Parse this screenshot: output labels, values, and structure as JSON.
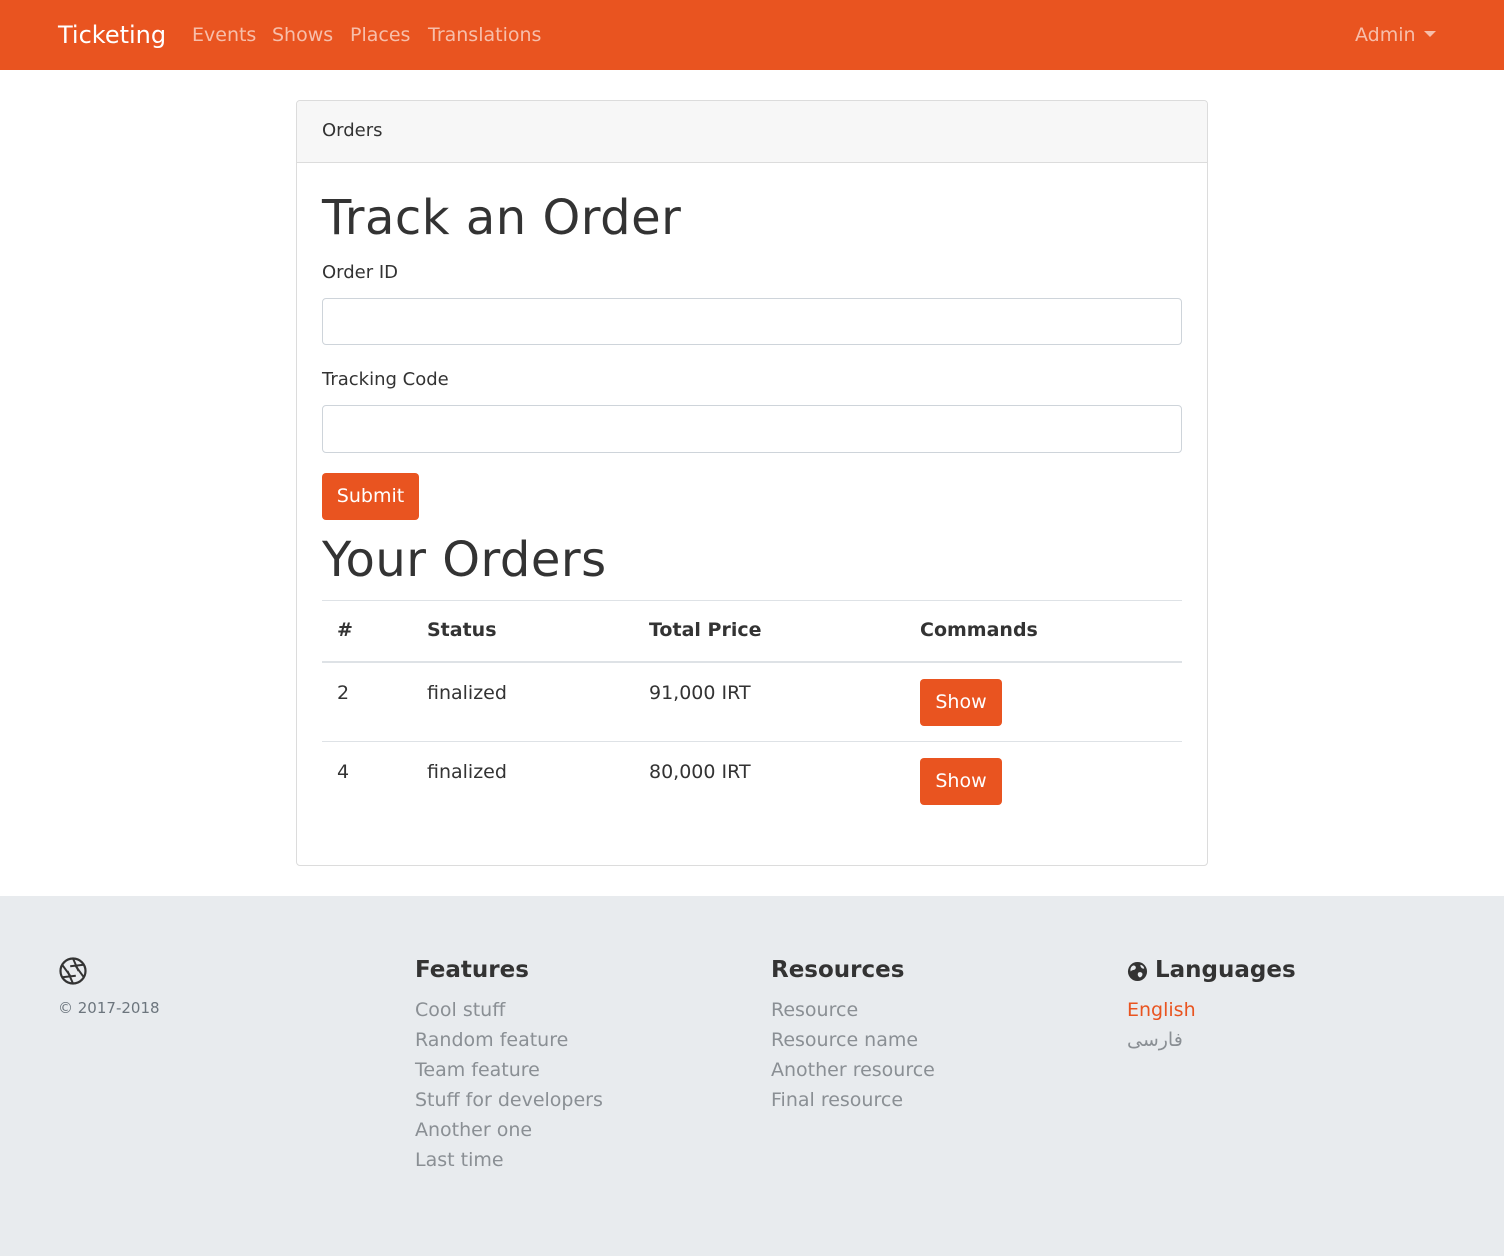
{
  "navbar": {
    "brand": "Ticketing",
    "links": [
      "Events",
      "Shows",
      "Places",
      "Translations"
    ],
    "user_menu": "Admin",
    "color": "#E95420"
  },
  "card": {
    "header": "Orders",
    "track_title": "Track an Order",
    "order_id_label": "Order ID",
    "order_id_value": "",
    "tracking_code_label": "Tracking Code",
    "tracking_code_value": "",
    "submit_label": "Submit",
    "orders_title": "Your Orders",
    "table": {
      "headers": [
        "#",
        "Status",
        "Total Price",
        "Commands"
      ],
      "rows": [
        {
          "id": "2",
          "status": "finalized",
          "total": "91,000 IRT",
          "command": "Show"
        },
        {
          "id": "4",
          "status": "finalized",
          "total": "80,000 IRT",
          "command": "Show"
        }
      ]
    }
  },
  "footer": {
    "logo_icon": "aperture-icon",
    "copyright": "© 2017-2018",
    "features": {
      "title": "Features",
      "links": [
        "Cool stuff",
        "Random feature",
        "Team feature",
        "Stuff for developers",
        "Another one",
        "Last time"
      ]
    },
    "resources": {
      "title": "Resources",
      "links": [
        "Resource",
        "Resource name",
        "Another resource",
        "Final resource"
      ]
    },
    "languages": {
      "icon": "globe-icon",
      "title": "Languages",
      "links": [
        "English",
        "فارسی"
      ],
      "active": "English"
    }
  }
}
